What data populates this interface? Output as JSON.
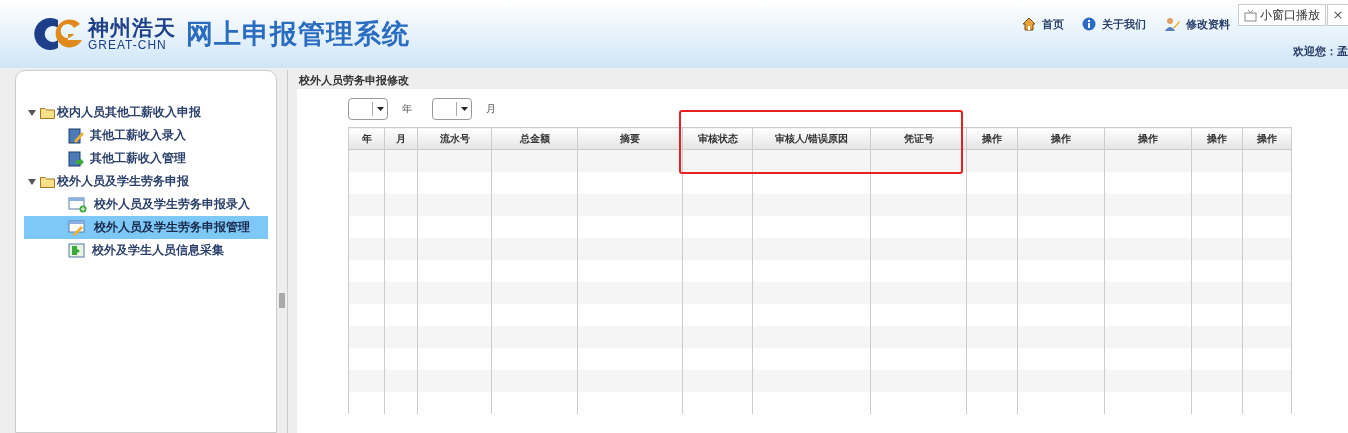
{
  "header": {
    "logo_cn": "神州浩天",
    "logo_en": "GREAT-CHN",
    "title": "网上申报管理系统",
    "nav": [
      {
        "label": "首页",
        "kind": "home"
      },
      {
        "label": "关于我们",
        "kind": "info"
      },
      {
        "label": "修改资料",
        "kind": "user"
      }
    ],
    "welcome": "欢迎您：孟"
  },
  "popup": {
    "label": "小窗口播放",
    "close": "×"
  },
  "sidebar": {
    "items": [
      {
        "label": "校内人员其他工薪收入申报",
        "expanded": true,
        "children": [
          {
            "label": "其他工薪收入录入",
            "kind": "edit",
            "selected": false
          },
          {
            "label": "其他工薪收入管理",
            "kind": "export",
            "selected": false
          }
        ]
      },
      {
        "label": "校外人员及学生劳务申报",
        "expanded": true,
        "children": [
          {
            "label": "校外人员及学生劳务申报录入",
            "kind": "add",
            "selected": false
          },
          {
            "label": "校外人员及学生劳务申报管理",
            "kind": "edit2",
            "selected": true
          },
          {
            "label": "校外及学生人员信息采集",
            "kind": "enter",
            "selected": false
          }
        ]
      }
    ]
  },
  "main": {
    "title": "校外人员劳务申报修改",
    "filters": [
      {
        "unit": "年"
      },
      {
        "unit": "月"
      }
    ],
    "table": {
      "columns": [
        "年",
        "月",
        "流水号",
        "总金额",
        "摘要",
        "审核状态",
        "审核人/错误原因",
        "凭证号",
        "操作",
        "操作",
        "操作",
        "操作",
        "操作"
      ]
    }
  }
}
